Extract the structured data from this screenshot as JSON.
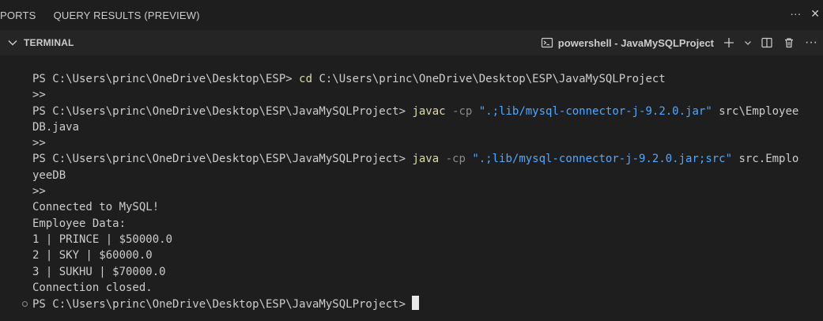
{
  "tabs": [
    {
      "label": "PORTS"
    },
    {
      "label": "QUERY RESULTS (PREVIEW)"
    }
  ],
  "panel": {
    "title": "TERMINAL",
    "shell_label": "powershell - JavaMySQLProject",
    "icons": [
      "terminal-icon",
      "plus-icon",
      "chevron-down-icon",
      "split-icon",
      "trash-icon",
      "more-icon"
    ]
  },
  "terminal": {
    "lines": [
      {
        "prompt": "PS C:\\Users\\princ\\OneDrive\\Desktop\\ESP> ",
        "cmd": "cd",
        "rest": " C:\\Users\\princ\\OneDrive\\Desktop\\ESP\\JavaMySQLProject"
      },
      {
        "text": ">>"
      },
      {
        "prompt": "PS C:\\Users\\princ\\OneDrive\\Desktop\\ESP\\JavaMySQLProject> ",
        "cmd": "javac",
        "param": " -cp ",
        "str": "\".;lib/mysql-connector-j-9.2.0.jar\"",
        "rest": " src\\Employee"
      },
      {
        "text": "DB.java"
      },
      {
        "text": ">>"
      },
      {
        "prompt": "PS C:\\Users\\princ\\OneDrive\\Desktop\\ESP\\JavaMySQLProject> ",
        "cmd": "java",
        "param": " -cp ",
        "str": "\".;lib/mysql-connector-j-9.2.0.jar;src\"",
        "rest": " src.Emplo"
      },
      {
        "text": "yeeDB"
      },
      {
        "text": ">>"
      },
      {
        "text": "Connected to MySQL!"
      },
      {
        "text": "Employee Data:"
      },
      {
        "text": "1 | PRINCE | $50000.0"
      },
      {
        "text": "2 | SKY | $60000.0"
      },
      {
        "text": "3 | SUKHU | $70000.0"
      },
      {
        "text": "Connection closed."
      },
      {
        "prompt": "PS C:\\Users\\princ\\OneDrive\\Desktop\\ESP\\JavaMySQLProject> ",
        "cursor": true
      }
    ]
  },
  "colors": {
    "command": "#dcdcaa",
    "parameter": "#8a8a8a",
    "string": "#4fa8ff"
  }
}
